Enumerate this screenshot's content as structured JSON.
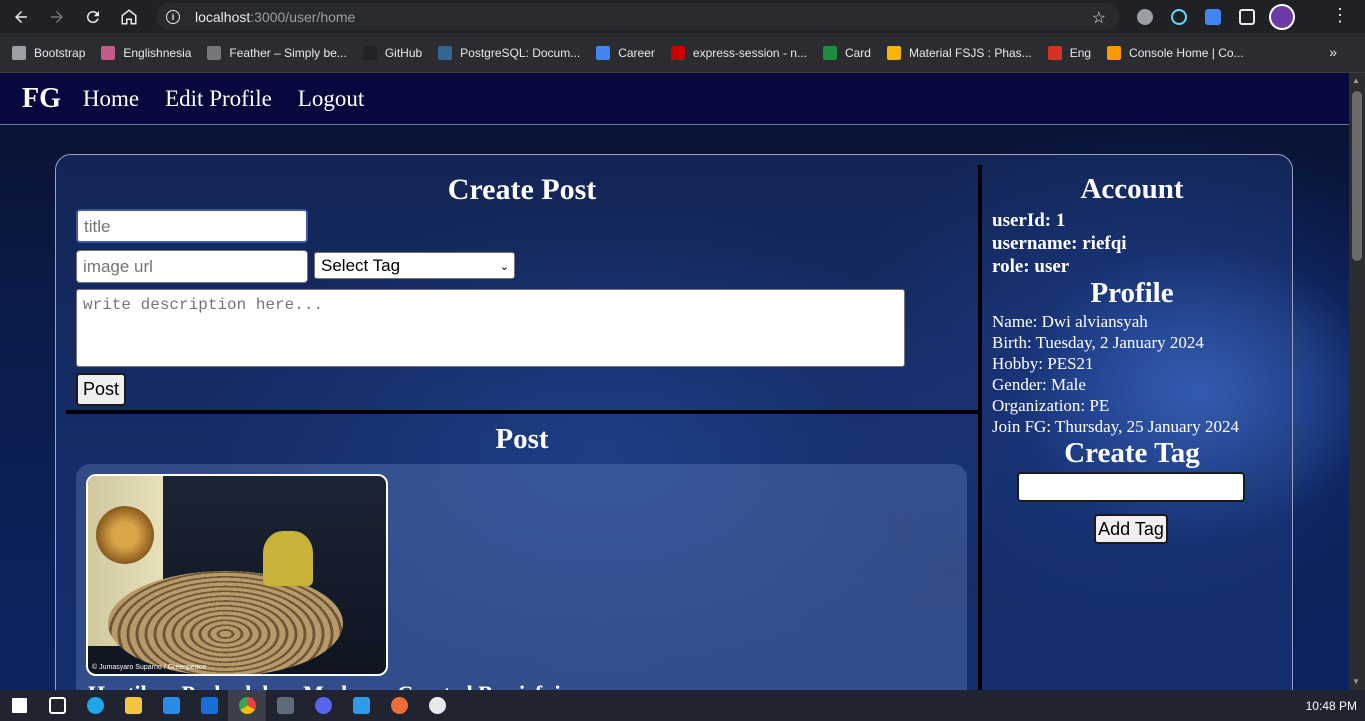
{
  "browser": {
    "url_host": "localhost",
    "url_path": ":3000/user/home",
    "bookmarks": [
      {
        "label": "Bootstrap",
        "color": "#9aa0a6"
      },
      {
        "label": "Englishnesia",
        "color": "#c45a8c"
      },
      {
        "label": "Feather – Simply be...",
        "color": "#777777"
      },
      {
        "label": "GitHub",
        "color": "#222222"
      },
      {
        "label": "PostgreSQL: Docum...",
        "color": "#336791"
      },
      {
        "label": "Career",
        "color": "#4285f4"
      },
      {
        "label": "express-session - n...",
        "color": "#cb0000"
      },
      {
        "label": "Card",
        "color": "#1e8e3e"
      },
      {
        "label": "Material FSJS : Phas...",
        "color": "#f4b400"
      },
      {
        "label": "Eng",
        "color": "#d93025"
      },
      {
        "label": "Console Home | Co...",
        "color": "#ff9900"
      }
    ]
  },
  "navbar": {
    "brand": "FG",
    "links": [
      "Home",
      "Edit Profile",
      "Logout"
    ]
  },
  "create_post": {
    "heading": "Create Post",
    "title_placeholder": "title",
    "image_placeholder": "image url",
    "tag_select": "Select Tag",
    "description_placeholder": "write description here...",
    "post_button": "Post"
  },
  "posts": {
    "heading": "Post",
    "items": [
      {
        "title": "Hentikan Perbudakan Modern - Created By riefqi",
        "image_credit": "© Jumasyaro Suparno / Greenpeace"
      }
    ]
  },
  "account": {
    "heading": "Account",
    "user_id": "userId: 1",
    "username": "username: riefqi",
    "role": "role: user"
  },
  "profile": {
    "heading": "Profile",
    "name": "Name: Dwi alviansyah",
    "birth": "Birth: Tuesday, 2 January 2024",
    "hobby": "Hobby: PES21",
    "gender": "Gender: Male",
    "organization": "Organization: PE",
    "join": "Join FG: Thursday, 25 January 2024"
  },
  "create_tag": {
    "heading": "Create Tag",
    "button": "Add Tag"
  },
  "taskbar": {
    "time": "10:48 PM"
  }
}
